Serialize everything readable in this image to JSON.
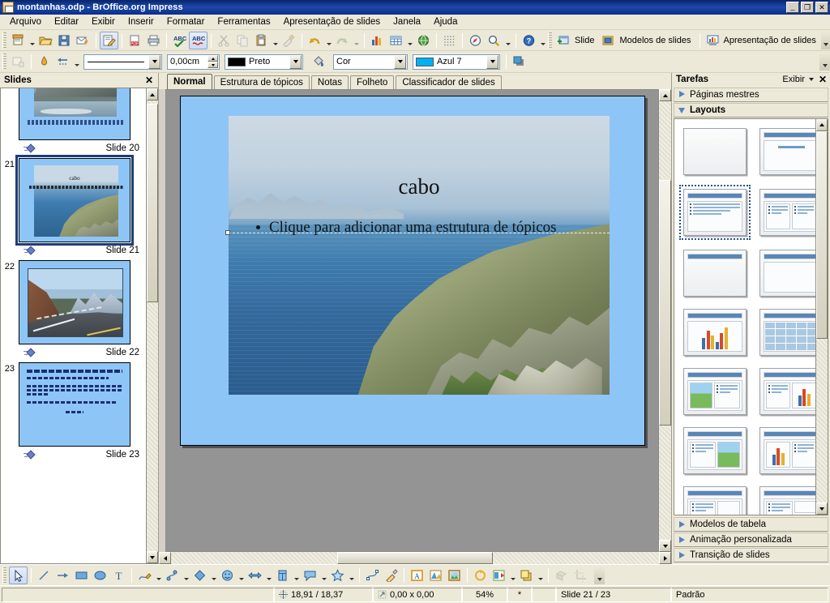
{
  "window": {
    "title": "montanhas.odp - BrOffice.org Impress",
    "app_icon": "impress-document-icon",
    "buttons": {
      "minimize": "_",
      "restore": "❐",
      "close": "✕"
    }
  },
  "menubar": {
    "items": [
      {
        "label": "Arquivo",
        "accel": "A"
      },
      {
        "label": "Editar",
        "accel": "E"
      },
      {
        "label": "Exibir",
        "accel": "x"
      },
      {
        "label": "Inserir",
        "accel": "I"
      },
      {
        "label": "Formatar",
        "accel": "F"
      },
      {
        "label": "Ferramentas",
        "accel": "r"
      },
      {
        "label": "Apresentação de slides",
        "accel": "s"
      },
      {
        "label": "Janela",
        "accel": "J"
      },
      {
        "label": "Ajuda",
        "accel": "u"
      }
    ]
  },
  "standard_toolbar": {
    "items": [
      {
        "name": "new-document",
        "icon": "new-doc-icon",
        "dropdown": true
      },
      {
        "name": "open",
        "icon": "open-folder-icon"
      },
      {
        "name": "save",
        "icon": "floppy-save-icon"
      },
      {
        "name": "send-document-as-email",
        "icon": "envelope-icon"
      },
      {
        "name": "edit-file",
        "icon": "edit-file-icon",
        "active": true
      },
      {
        "name": "export-as-pdf",
        "icon": "pdf-icon"
      },
      {
        "name": "print-file-directly",
        "icon": "printer-icon"
      },
      {
        "name": "spelling-and-grammar",
        "icon": "abc-check-icon"
      },
      {
        "name": "autospellcheck",
        "icon": "abc-underline-icon",
        "active": true
      },
      {
        "name": "cut",
        "icon": "scissors-icon",
        "disabled": true
      },
      {
        "name": "copy",
        "icon": "copy-icon",
        "disabled": true
      },
      {
        "name": "paste",
        "icon": "clipboard-icon",
        "dropdown": true
      },
      {
        "name": "clone-formatting",
        "icon": "paintbrush-icon",
        "disabled": true
      },
      {
        "name": "undo",
        "icon": "undo-arrow-icon",
        "dropdown": true
      },
      {
        "name": "redo",
        "icon": "redo-arrow-icon",
        "dropdown": true,
        "disabled": true
      },
      {
        "name": "insert-chart",
        "icon": "bar-chart-icon"
      },
      {
        "name": "insert-table",
        "icon": "table-grid-icon",
        "dropdown": true
      },
      {
        "name": "hyperlink",
        "icon": "globe-icon"
      },
      {
        "name": "display-grid",
        "icon": "grid-dots-icon"
      },
      {
        "name": "navigator",
        "icon": "compass-icon"
      },
      {
        "name": "zoom",
        "icon": "magnifier-icon",
        "dropdown": true
      },
      {
        "name": "help",
        "icon": "help-question-icon"
      }
    ],
    "text_buttons": [
      {
        "name": "slide",
        "label": "Slide",
        "icon": "new-slide-icon"
      },
      {
        "name": "slide-master",
        "label": "Modelos de slides",
        "icon": "slide-master-icon"
      },
      {
        "name": "start-slideshow",
        "label": "Apresentação de slides",
        "icon": "presentation-icon"
      }
    ]
  },
  "line_toolbar": {
    "items": [
      {
        "name": "position-and-size",
        "icon": "position-size-icon",
        "disabled": true
      },
      {
        "name": "glue-points",
        "icon": "glue-point-icon"
      },
      {
        "name": "arrow-style",
        "icon": "arrow-style-icon",
        "dropdown": true
      }
    ],
    "line_style": {
      "label": "line-style-preview",
      "value": "——————"
    },
    "line_width": {
      "value": "0,00cm"
    },
    "line_color": {
      "value": "Preto",
      "hex": "#000000"
    },
    "area_style_icon": "fill-bucket-icon",
    "area_style": {
      "value": "Cor"
    },
    "area_color": {
      "value": "Azul 7",
      "hex": "#00b0f0"
    },
    "shadow": {
      "name": "shadow-button",
      "icon": "shadow-icon"
    }
  },
  "slides_panel": {
    "title": "Slides",
    "close_label": "✕",
    "slides": [
      {
        "number": "",
        "label": "Slide 20",
        "type": "photo-mountain-coast",
        "selected": false,
        "partial": true
      },
      {
        "number": "21",
        "label": "Slide 21",
        "type": "photo-cape-cliff",
        "selected": true,
        "title": "cabo",
        "body": "Clique para adicionar uma estrutura de tópicos"
      },
      {
        "number": "22",
        "label": "Slide 22",
        "type": "photo-mountain-road",
        "selected": false
      },
      {
        "number": "23",
        "label": "Slide 23",
        "type": "text-slide",
        "selected": false
      }
    ]
  },
  "view_tabs": {
    "tabs": [
      {
        "label": "Normal",
        "active": true
      },
      {
        "label": "Estrutura de tópicos",
        "active": false
      },
      {
        "label": "Notas",
        "active": false
      },
      {
        "label": "Folheto",
        "active": false
      },
      {
        "label": "Classificador de slides",
        "active": false
      }
    ]
  },
  "slide_editor": {
    "title_text": "cabo",
    "body_text": "Clique para adicionar uma estrutura de tópicos",
    "background_hex": "#8ec5f7",
    "canvas_bg_hex": "#949494"
  },
  "tasks_panel": {
    "title": "Tarefas",
    "view_label": "Exibir",
    "close_label": "✕",
    "sections": [
      {
        "label": "Páginas mestres",
        "open": false
      },
      {
        "label": "Layouts",
        "open": true
      },
      {
        "label": "Modelos de tabela",
        "open": false
      },
      {
        "label": "Animação personalizada",
        "open": false
      },
      {
        "label": "Transição de slides",
        "open": false
      }
    ],
    "layouts": [
      {
        "name": "blank-slide",
        "kind": "blank",
        "selected": false
      },
      {
        "name": "title-slide",
        "kind": "title-centered",
        "selected": false
      },
      {
        "name": "title-content",
        "kind": "title-bullets",
        "selected": true
      },
      {
        "name": "title-two-content",
        "kind": "title-two-bullets",
        "selected": false
      },
      {
        "name": "title-only",
        "kind": "title-only",
        "selected": false
      },
      {
        "name": "centered-text",
        "kind": "title-box",
        "selected": false
      },
      {
        "name": "title-chart",
        "kind": "title-chart",
        "selected": false
      },
      {
        "name": "title-spreadsheet",
        "kind": "title-table",
        "selected": false
      },
      {
        "name": "title-clipart-content",
        "kind": "title-image-bullets",
        "selected": false
      },
      {
        "name": "title-content-chart",
        "kind": "title-bullets-chart",
        "selected": false
      },
      {
        "name": "title-content-clipart",
        "kind": "title-bullets-image",
        "selected": false
      },
      {
        "name": "title-chart-content",
        "kind": "title-chart-bullets",
        "selected": false
      },
      {
        "name": "title-content-box",
        "kind": "title-bullets-box",
        "selected": false
      },
      {
        "name": "title-content-two-box",
        "kind": "title-bullets-twobox",
        "selected": false
      }
    ]
  },
  "drawing_toolbar": {
    "items": [
      {
        "name": "select",
        "icon": "cursor-arrow-icon",
        "active": true
      },
      {
        "name": "line",
        "icon": "line-icon"
      },
      {
        "name": "line-ends-with-arrow",
        "icon": "arrow-line-icon"
      },
      {
        "name": "rectangle",
        "icon": "rectangle-icon"
      },
      {
        "name": "ellipse",
        "icon": "ellipse-icon"
      },
      {
        "name": "text-box",
        "icon": "text-T-icon"
      },
      {
        "name": "curve",
        "icon": "curve-pencil-icon",
        "dropdown": true
      },
      {
        "name": "connector",
        "icon": "connector-icon",
        "dropdown": true
      },
      {
        "name": "basic-shapes",
        "icon": "diamond-shape-icon",
        "dropdown": true
      },
      {
        "name": "symbol-shapes",
        "icon": "smiley-icon",
        "dropdown": true
      },
      {
        "name": "block-arrows",
        "icon": "block-arrow-icon",
        "dropdown": true
      },
      {
        "name": "flowchart",
        "icon": "flowchart-icon",
        "dropdown": true
      },
      {
        "name": "callouts",
        "icon": "callout-bubble-icon",
        "dropdown": true
      },
      {
        "name": "stars",
        "icon": "star-icon",
        "dropdown": true
      },
      {
        "name": "points",
        "icon": "edit-points-icon"
      },
      {
        "name": "glue-points",
        "icon": "glue-pen-icon"
      },
      {
        "name": "from-file",
        "icon": "insert-textbox-icon"
      },
      {
        "name": "fontwork-gallery",
        "icon": "fontwork-icon"
      },
      {
        "name": "insert-image",
        "icon": "picture-icon"
      },
      {
        "name": "rotate",
        "icon": "rotate-icon"
      },
      {
        "name": "alignment",
        "icon": "align-icon",
        "dropdown": true
      },
      {
        "name": "arrange",
        "icon": "arrange-icon",
        "dropdown": true
      },
      {
        "name": "shadow",
        "icon": "shadow-3d-icon",
        "disabled": true
      },
      {
        "name": "crop",
        "icon": "crop-filter-icon",
        "disabled": true
      }
    ]
  },
  "status_bar": {
    "cursor_position": "18,91 / 18,37",
    "cursor_icon": "crosshair-icon",
    "object_size": "0,00 x 0,00",
    "size_icon": "resize-icon",
    "zoom": "54%",
    "modified": "*",
    "signature": "",
    "slide_position": "Slide 21 / 23",
    "master": "Padrão"
  }
}
